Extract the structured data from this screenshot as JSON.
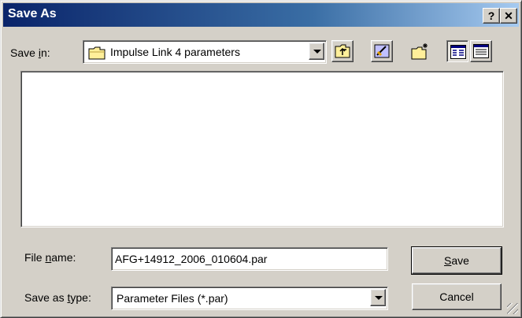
{
  "window": {
    "title": "Save As",
    "help_label": "?",
    "close_label": "✕"
  },
  "save_in": {
    "label_pre": "Save ",
    "label_ul": "i",
    "label_post": "n:",
    "value": "Impulse Link 4 parameters"
  },
  "toolbar": {
    "icons": [
      "up-one-level-icon",
      "desktop-icon",
      "new-folder-icon",
      "list-view-icon",
      "details-view-icon"
    ]
  },
  "file_name": {
    "label_pre": "File ",
    "label_ul": "n",
    "label_post": "ame:",
    "value": "AFG+14912_2006_010604.par"
  },
  "save_as_type": {
    "label_pre": "Save as ",
    "label_ul": "t",
    "label_post": "ype:",
    "value": "Parameter Files (*.par)"
  },
  "buttons": {
    "save_ul": "S",
    "save_rest": "ave",
    "cancel": "Cancel"
  }
}
